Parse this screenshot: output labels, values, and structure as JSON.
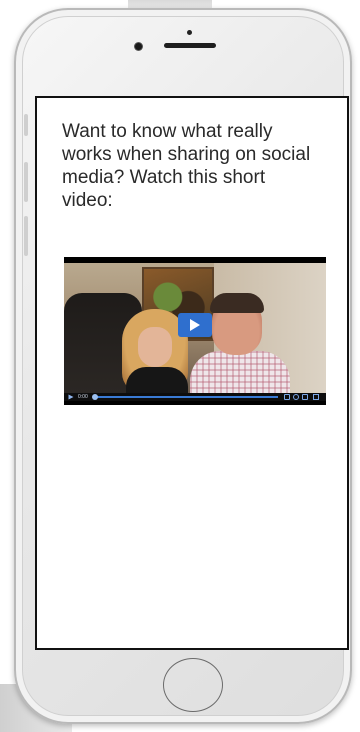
{
  "screen": {
    "message": "Want to know what really works when sharing on social media?   Watch this short video:"
  },
  "video": {
    "time": "0:00",
    "progress": 0.0,
    "accent_color": "#2f6fce"
  },
  "icons": {
    "play": "play-icon",
    "volume": "volume-icon",
    "settings": "settings-icon",
    "cast": "cast-icon",
    "fullscreen": "fullscreen-icon"
  }
}
